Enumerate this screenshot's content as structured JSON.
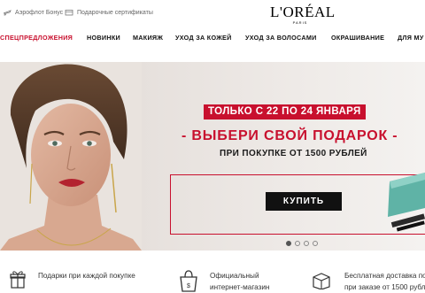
{
  "util": {
    "aeroflot": "Аэрофлот Бонус",
    "certificates": "Подарочные сертификаты"
  },
  "logo": {
    "brand": "L'ORÉAL",
    "sub": "PARIS"
  },
  "nav": {
    "items": [
      "СПЕЦПРЕДЛОЖЕНИЯ",
      "НОВИНКИ",
      "МАКИЯЖ",
      "УХОД ЗА КОЖЕЙ",
      "УХОД ЗА ВОЛОСАМИ",
      "ОКРАШИВАНИЕ",
      "ДЛЯ МУ"
    ]
  },
  "hero": {
    "dates": "ТОЛЬКО С 22 ПО 24 ЯНВАРЯ",
    "headline": "- ВЫБЕРИ СВОЙ ПОДАРОК -",
    "condition": "ПРИ ПОКУПКЕ ОТ 1500 РУБЛЕЙ",
    "cta": "КУПИТЬ",
    "slides_total": 4,
    "active_slide": 1
  },
  "features": {
    "gifts": "Подарки при каждой покупке",
    "official_1": "Официальный",
    "official_2": "интернет-магазин",
    "delivery_1": "Бесплатная доставка по",
    "delivery_2": "при заказе от 1500 рубл"
  },
  "colors": {
    "accent": "#c8102e",
    "dark": "#111111"
  }
}
